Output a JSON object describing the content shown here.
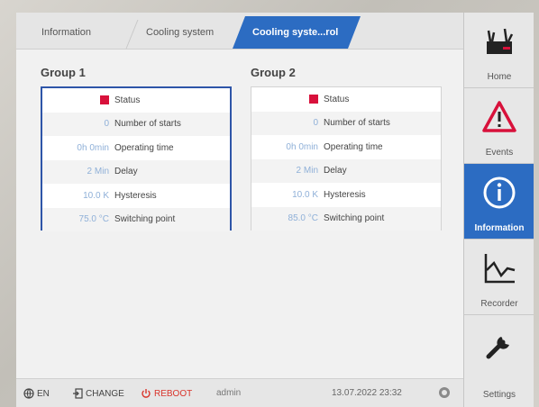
{
  "tabs": [
    {
      "label": "Information"
    },
    {
      "label": "Cooling system"
    },
    {
      "label": "Cooling syste...rol"
    }
  ],
  "groups": [
    {
      "title": "Group 1",
      "rows": [
        {
          "value": "",
          "label": "Status"
        },
        {
          "value": "0",
          "label": "Number of starts"
        },
        {
          "value": "0h 0min",
          "label": "Operating time"
        },
        {
          "value": "2 Min",
          "label": "Delay"
        },
        {
          "value": "10.0 K",
          "label": "Hysteresis"
        },
        {
          "value": "75.0 °C",
          "label": "Switching point"
        }
      ]
    },
    {
      "title": "Group 2",
      "rows": [
        {
          "value": "",
          "label": "Status"
        },
        {
          "value": "0",
          "label": "Number of starts"
        },
        {
          "value": "0h 0min",
          "label": "Operating time"
        },
        {
          "value": "2 Min",
          "label": "Delay"
        },
        {
          "value": "10.0 K",
          "label": "Hysteresis"
        },
        {
          "value": "85.0 °C",
          "label": "Switching point"
        }
      ]
    }
  ],
  "statusbar": {
    "language": "EN",
    "change": "CHANGE",
    "reboot": "REBOOT",
    "user": "admin",
    "datetime": "13.07.2022 23:32"
  },
  "nav": [
    {
      "label": "Home",
      "icon": "home-device-icon"
    },
    {
      "label": "Events",
      "icon": "warning-triangle-icon"
    },
    {
      "label": "Information",
      "icon": "info-circle-icon"
    },
    {
      "label": "Recorder",
      "icon": "chart-line-icon"
    },
    {
      "label": "Settings",
      "icon": "wrench-icon"
    }
  ],
  "colors": {
    "accent": "#2c6cc2",
    "status_red": "#d8113b",
    "reboot_red": "#d9342b",
    "value_blue": "#8fb0d8"
  }
}
